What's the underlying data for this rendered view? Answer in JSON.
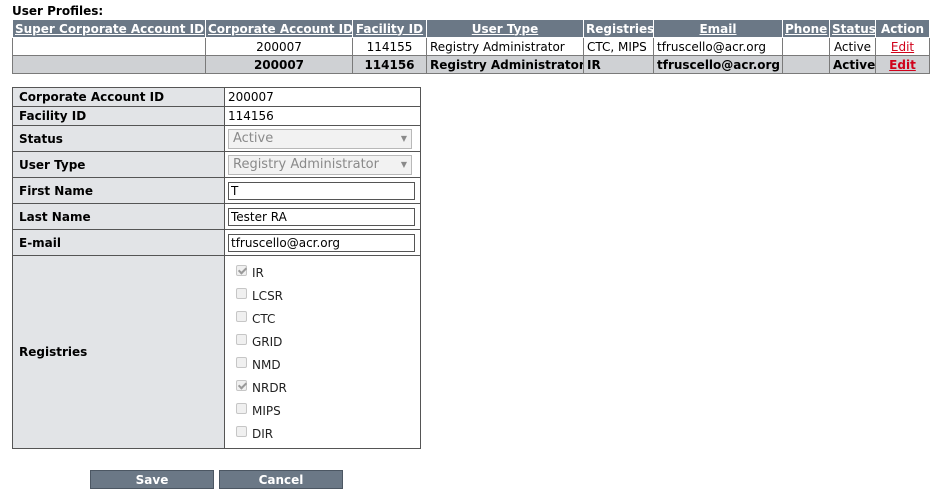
{
  "section_title": "User Profiles:",
  "profiles_table": {
    "headers": [
      "Super Corporate Account ID",
      "Corporate Account ID",
      "Facility ID",
      "User Type",
      "Registries",
      "Email",
      "Phone",
      "Status",
      "Action"
    ],
    "rows": [
      {
        "super_corp_id": "",
        "corp_id": "200007",
        "facility_id": "114155",
        "user_type": "Registry Administrator",
        "registries": "CTC, MIPS",
        "email": "tfruscello@acr.org",
        "phone": "",
        "status": "Active",
        "action": "Edit"
      },
      {
        "super_corp_id": "",
        "corp_id": "200007",
        "facility_id": "114156",
        "user_type": "Registry Administrator",
        "registries": "IR",
        "email": "tfruscello@acr.org",
        "phone": "",
        "status": "Active",
        "action": "Edit"
      }
    ]
  },
  "detail": {
    "corp_id_label": "Corporate Account ID",
    "corp_id_value": "200007",
    "facility_id_label": "Facility ID",
    "facility_id_value": "114156",
    "status_label": "Status",
    "status_value": "Active",
    "user_type_label": "User Type",
    "user_type_value": "Registry Administrator",
    "first_name_label": "First Name",
    "first_name_value": "T",
    "last_name_label": "Last Name",
    "last_name_value": "Tester RA",
    "email_label": "E-mail",
    "email_value": "tfruscello@acr.org",
    "registries_label": "Registries",
    "registries": [
      {
        "label": "IR",
        "checked": true
      },
      {
        "label": "LCSR",
        "checked": false
      },
      {
        "label": "CTC",
        "checked": false
      },
      {
        "label": "GRID",
        "checked": false
      },
      {
        "label": "NMD",
        "checked": false
      },
      {
        "label": "NRDR",
        "checked": true
      },
      {
        "label": "MIPS",
        "checked": false
      },
      {
        "label": "DIR",
        "checked": false
      }
    ]
  },
  "buttons": {
    "save_label": "Save",
    "cancel_label": "Cancel"
  },
  "colors": {
    "header_bg": "#6b7886",
    "selected_row_bg": "#cfd1d4",
    "label_bg": "#e2e4e7",
    "link": "#d0021b"
  },
  "icons": {
    "dropdown": "chevron-down-icon",
    "checkbox_checked": "checkmark-icon"
  }
}
